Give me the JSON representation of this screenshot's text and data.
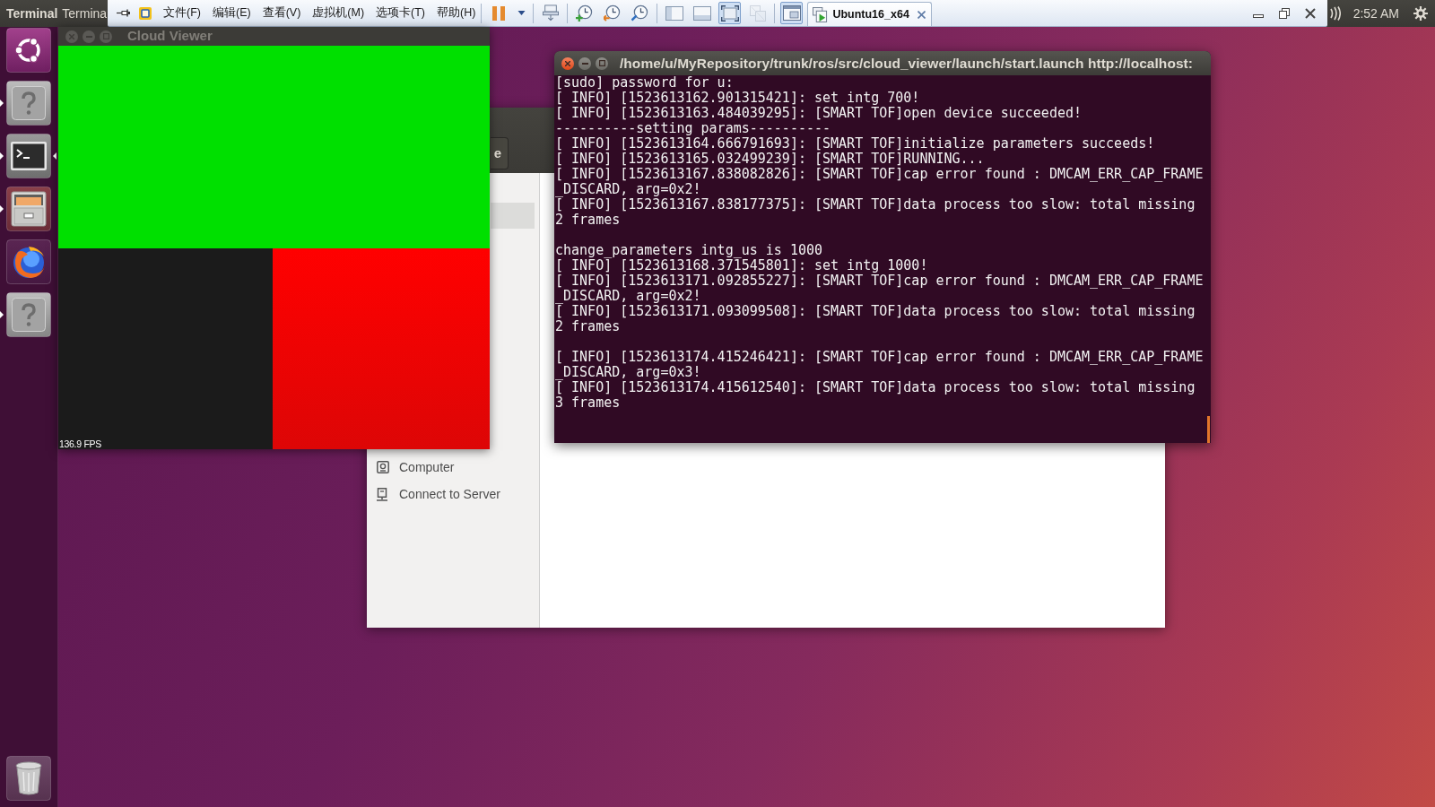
{
  "top_panel": {
    "app_name": "Terminal",
    "window_title": "Termina",
    "clock": "2:52 AM"
  },
  "vm_toolbar": {
    "menus": [
      "文件(F)",
      "编辑(E)",
      "查看(V)",
      "虚拟机(M)",
      "选项卡(T)",
      "帮助(H)"
    ],
    "tool_groups": [
      [
        {
          "kind": "pause",
          "pressed": false,
          "disabled": false
        },
        {
          "kind": "dropdown",
          "pressed": false,
          "disabled": false
        }
      ],
      [
        {
          "kind": "send_keys",
          "pressed": false,
          "disabled": false
        }
      ],
      [
        {
          "kind": "snapshot_take",
          "pressed": false,
          "disabled": false
        },
        {
          "kind": "snapshot_revert",
          "pressed": false,
          "disabled": false
        },
        {
          "kind": "snapshot_manager",
          "pressed": false,
          "disabled": false
        }
      ],
      [
        {
          "kind": "library",
          "pressed": false,
          "disabled": false
        },
        {
          "kind": "thumbnails",
          "pressed": false,
          "disabled": false
        },
        {
          "kind": "fullscreen",
          "pressed": true,
          "disabled": false
        },
        {
          "kind": "unity",
          "pressed": false,
          "disabled": true
        }
      ],
      [
        {
          "kind": "console_view",
          "pressed": true,
          "disabled": false
        }
      ]
    ],
    "tabs": [
      {
        "label": "Ubuntu16_x64",
        "selected": true
      }
    ]
  },
  "launcher": {
    "items": [
      {
        "kind": "dash",
        "running": false,
        "focused": false
      },
      {
        "kind": "unknown",
        "running": true,
        "focused": false
      },
      {
        "kind": "terminal",
        "running": true,
        "focused": true
      },
      {
        "kind": "files",
        "running": true,
        "focused": false
      },
      {
        "kind": "browser",
        "running": false,
        "focused": false
      },
      {
        "kind": "unknown",
        "running": true,
        "focused": false
      },
      {
        "kind": "trash",
        "running": false,
        "focused": false
      }
    ]
  },
  "cloud_viewer": {
    "title": "Cloud Viewer",
    "active": false,
    "fps": "136.9 FPS"
  },
  "file_manager": {
    "header_button": "e",
    "sidebar": {
      "items": [
        {
          "kind": "computer",
          "label": "Computer"
        },
        {
          "kind": "server",
          "label": "Connect to Server"
        }
      ]
    }
  },
  "terminal": {
    "title": "/home/u/MyRepository/trunk/ros/src/cloud_viewer/launch/start.launch http://localhost:",
    "active": true,
    "output_blocks": [
      {
        "lines": [
          "[sudo] password for u:",
          "[ INFO] [1523613162.901315421]: set intg 700!",
          "[ INFO] [1523613163.484039295]: [SMART TOF]open device succeeded!",
          "----------setting params----------",
          "[ INFO] [1523613164.666791693]: [SMART TOF]initialize parameters succeeds!",
          "[ INFO] [1523613165.032499239]: [SMART TOF]RUNNING...",
          "[ INFO] [1523613167.838082826]: [SMART TOF]cap error found : DMCAM_ERR_CAP_FRAME_DISCARD, arg=0x2!",
          "[ INFO] [1523613167.838177375]: [SMART TOF]data process too slow: total missing 2 frames"
        ]
      },
      {
        "lines": [
          "change_parameters intg_us is 1000",
          "[ INFO] [1523613168.371545801]: set intg 1000!",
          "[ INFO] [1523613171.092855227]: [SMART TOF]cap error found : DMCAM_ERR_CAP_FRAME_DISCARD, arg=0x2!",
          "[ INFO] [1523613171.093099508]: [SMART TOF]data process too slow: total missing 2 frames"
        ]
      },
      {
        "lines": [
          "[ INFO] [1523613174.415246421]: [SMART TOF]cap error found : DMCAM_ERR_CAP_FRAME_DISCARD, arg=0x3!",
          "[ INFO] [1523613174.415612540]: [SMART TOF]data process too slow: total missing 3 frames"
        ]
      }
    ]
  }
}
